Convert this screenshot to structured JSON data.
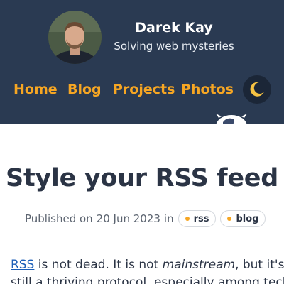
{
  "header": {
    "site_name": "Darek Kay",
    "tagline": "Solving web mysteries"
  },
  "nav": {
    "items": [
      {
        "label": "Home"
      },
      {
        "label": "Blog"
      },
      {
        "label": "Projects"
      },
      {
        "label": "Photos"
      }
    ],
    "theme_toggle_icon": "moon-icon"
  },
  "article": {
    "title": "Style your RSS feed",
    "meta_prefix": "Published on",
    "date": "20 Jun 2023",
    "meta_in": "in",
    "tags": [
      "rss",
      "blog"
    ],
    "intro": {
      "link_text": "RSS",
      "part1": " is not dead. It is not ",
      "emphasis": "mainstream",
      "part2": ", but it's",
      "line2": "still a thriving protocol, especially among tech"
    }
  },
  "colors": {
    "header_bg": "#2a3a52",
    "accent": "#f6a623",
    "link": "#1d5fb8",
    "text": "#2b3445"
  }
}
